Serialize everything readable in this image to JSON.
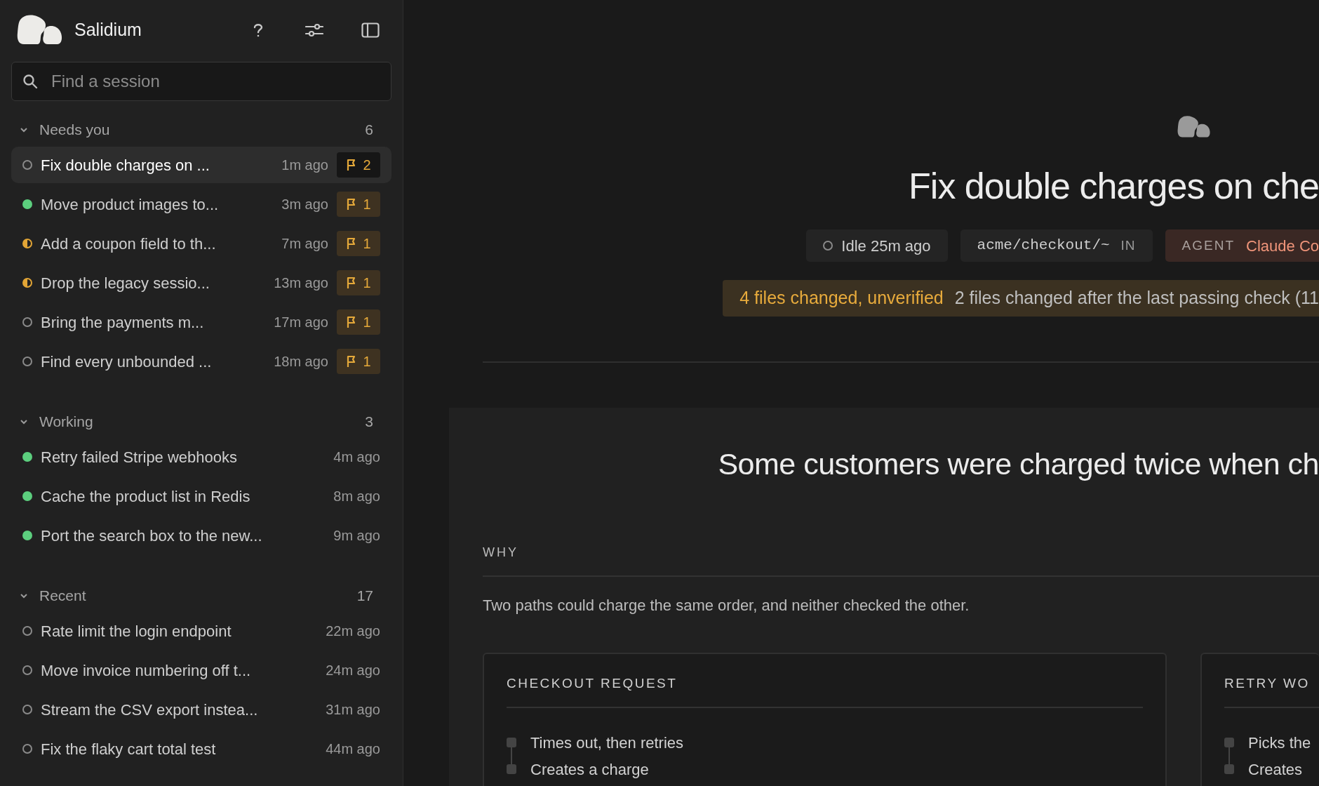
{
  "app": {
    "name": "Salidium"
  },
  "search": {
    "placeholder": "Find a session"
  },
  "groups": [
    {
      "label": "Needs you",
      "count": "6",
      "expanded": true,
      "items": [
        {
          "title": "Fix double charges on ...",
          "time": "1m ago",
          "kind": "idle",
          "flags": "2",
          "selected": true
        },
        {
          "title": "Move product images to...",
          "time": "3m ago",
          "kind": "working",
          "flags": "1",
          "selected": false
        },
        {
          "title": "Add a coupon field to th...",
          "time": "7m ago",
          "kind": "half",
          "flags": "1",
          "selected": false
        },
        {
          "title": "Drop the legacy sessio...",
          "time": "13m ago",
          "kind": "half",
          "flags": "1",
          "selected": false
        },
        {
          "title": "Bring the payments m...",
          "time": "17m ago",
          "kind": "idle",
          "flags": "1",
          "selected": false
        },
        {
          "title": "Find every unbounded ...",
          "time": "18m ago",
          "kind": "idle",
          "flags": "1",
          "selected": false
        }
      ]
    },
    {
      "label": "Working",
      "count": "3",
      "expanded": true,
      "items": [
        {
          "title": "Retry failed Stripe webhooks",
          "time": "4m ago",
          "kind": "working",
          "selected": false
        },
        {
          "title": "Cache the product list in Redis",
          "time": "8m ago",
          "kind": "working",
          "selected": false
        },
        {
          "title": "Port the search box to the new...",
          "time": "9m ago",
          "kind": "working",
          "selected": false
        }
      ]
    },
    {
      "label": "Recent",
      "count": "17",
      "expanded": true,
      "items": [
        {
          "title": "Rate limit the login endpoint",
          "time": "22m ago",
          "kind": "idle",
          "selected": false
        },
        {
          "title": "Move invoice numbering off t...",
          "time": "24m ago",
          "kind": "idle",
          "selected": false
        },
        {
          "title": "Stream the CSV export instea...",
          "time": "31m ago",
          "kind": "idle",
          "selected": false
        },
        {
          "title": "Fix the flaky cart total test",
          "time": "44m ago",
          "kind": "idle",
          "selected": false
        }
      ]
    }
  ],
  "session": {
    "title": "Fix double charges on che",
    "chips": [
      {
        "kind": "idle",
        "text": "Idle 25m ago"
      },
      {
        "kind": "path",
        "text": "acme/checkout/~",
        "suffix": "IN"
      },
      {
        "kind": "agent",
        "label": "AGENT",
        "value": "Claude Co"
      }
    ],
    "banner": {
      "emphasis": "4 files changed, unverified",
      "text": "2 files changed after the last passing check (11"
    },
    "summary": "Some customers were charged twice when ch",
    "why": {
      "heading": "WHY",
      "text": "Two paths could charge the same order, and neither checked the other."
    },
    "cards": [
      {
        "heading": "CHECKOUT REQUEST",
        "steps": [
          "Times out, then retries",
          "Creates a charge"
        ]
      },
      {
        "heading": "RETRY WO",
        "steps": [
          "Picks the",
          "Creates"
        ]
      }
    ]
  }
}
